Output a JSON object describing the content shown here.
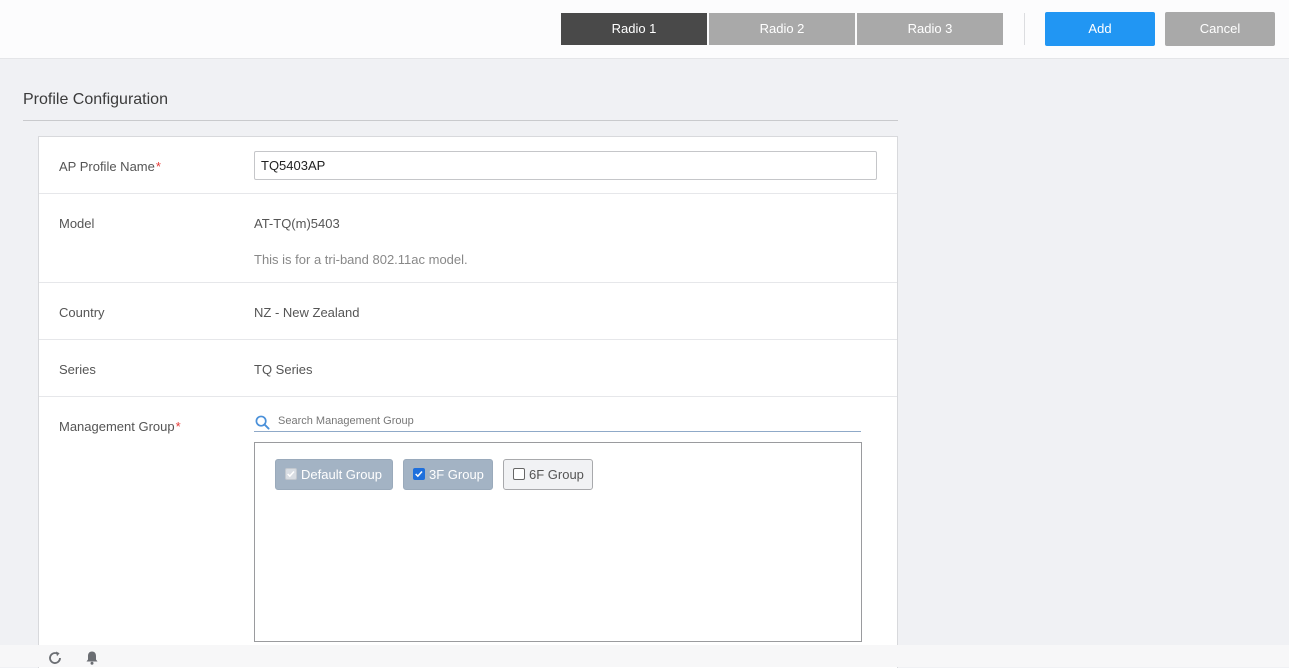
{
  "header": {
    "tabs": [
      {
        "label": "Radio 1",
        "active": true
      },
      {
        "label": "Radio 2",
        "active": false
      },
      {
        "label": "Radio 3",
        "active": false
      }
    ],
    "add_label": "Add",
    "cancel_label": "Cancel"
  },
  "section": {
    "title": "Profile Configuration"
  },
  "form": {
    "profile_name": {
      "label": "AP Profile Name",
      "required_mark": "*",
      "value": "TQ5403AP"
    },
    "model": {
      "label": "Model",
      "value": "AT-TQ(m)5403",
      "hint": "This is for a tri-band 802.11ac model."
    },
    "country": {
      "label": "Country",
      "value": "NZ - New Zealand"
    },
    "series": {
      "label": "Series",
      "value": "TQ Series"
    },
    "management_group": {
      "label": "Management Group",
      "required_mark": "*",
      "search_placeholder": "Search Management Group",
      "groups": [
        {
          "label": "Default Group",
          "checked": true,
          "disabled": true
        },
        {
          "label": "3F Group",
          "checked": true,
          "disabled": false
        },
        {
          "label": "6F Group",
          "checked": false,
          "disabled": false
        }
      ]
    }
  },
  "icons": {
    "search": "search-icon",
    "refresh": "refresh-icon",
    "bell": "bell-icon"
  },
  "colors": {
    "primary": "#2196f3",
    "tab_active": "#494949",
    "tab_inactive": "#a9a9a9",
    "required": "#e53935",
    "chip_selected": "#a3b3c4"
  }
}
